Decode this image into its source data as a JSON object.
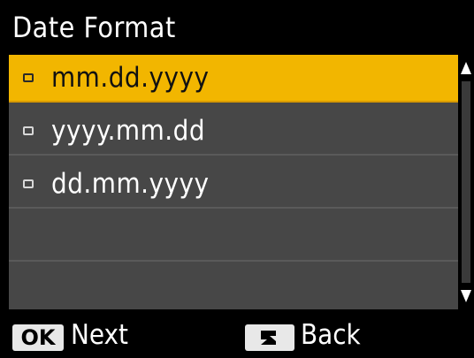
{
  "title": "Date Format",
  "options": [
    {
      "label": "mm.dd.yyyy",
      "selected": true
    },
    {
      "label": "yyyy.mm.dd",
      "selected": false
    },
    {
      "label": "dd.mm.yyyy",
      "selected": false
    }
  ],
  "footer": {
    "ok_key": "OK",
    "ok_label": "Next",
    "back_key": "back-icon",
    "back_label": "Back"
  },
  "colors": {
    "selected": "#f2b600",
    "list_bg": "#474747",
    "background": "#000000"
  }
}
